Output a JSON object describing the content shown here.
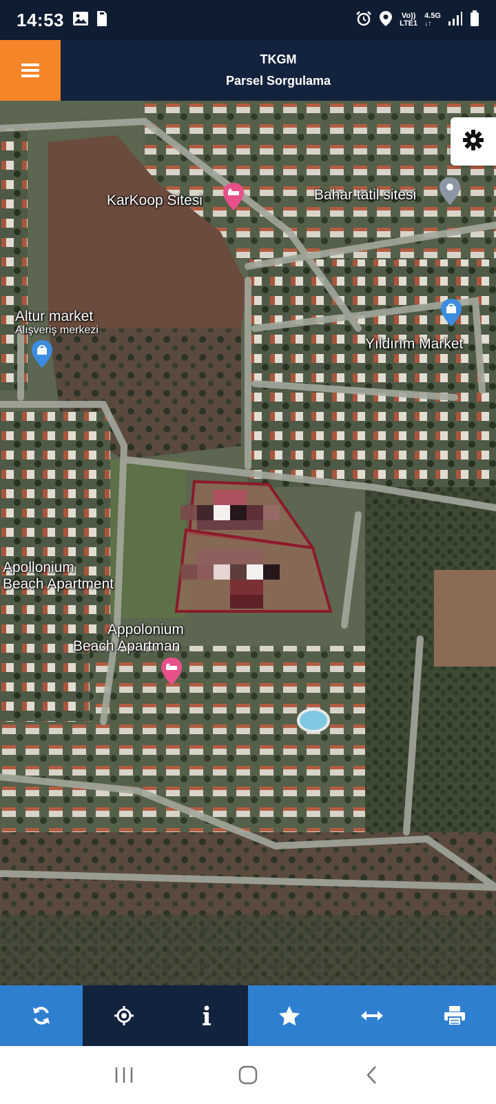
{
  "status_bar": {
    "time": "14:53",
    "network_top": "Vo))",
    "network_bottom": "LTE1",
    "network_type": "4.5G",
    "icons": [
      "image-icon",
      "sim-card-icon",
      "alarm-icon",
      "location-icon",
      "signal-icon",
      "battery-icon"
    ]
  },
  "header": {
    "title": "TKGM",
    "subtitle": "Parsel Sorgulama",
    "menu_color": "#f58529",
    "bar_color": "#13223d"
  },
  "map": {
    "labels": {
      "karkoop": "KarKoop Sitesi",
      "bahar": "Bahar tatil sitesi",
      "altur": "Altur market",
      "altur_sub": "Alışveriş merkezi",
      "yildirim": "Yıldırım Market",
      "apollonium": "Apollonium",
      "apollonium2": "Beach Apartment",
      "appolonium": "Appolonium",
      "appolonium2": "Beach Apartman"
    },
    "parcel_color": "#8b1a2b"
  },
  "toolbar": {
    "items": [
      {
        "icon": "refresh-icon",
        "active": false
      },
      {
        "icon": "crosshair-icon",
        "active": true
      },
      {
        "icon": "info-icon",
        "active": true
      },
      {
        "icon": "star-icon",
        "active": false
      },
      {
        "icon": "measure-icon",
        "active": false
      },
      {
        "icon": "print-icon",
        "active": false
      }
    ],
    "color": "#2f7fd0",
    "active_color": "#13223d"
  },
  "nav_bar": {
    "icons": [
      "recent-apps-icon",
      "home-icon",
      "back-icon"
    ]
  }
}
